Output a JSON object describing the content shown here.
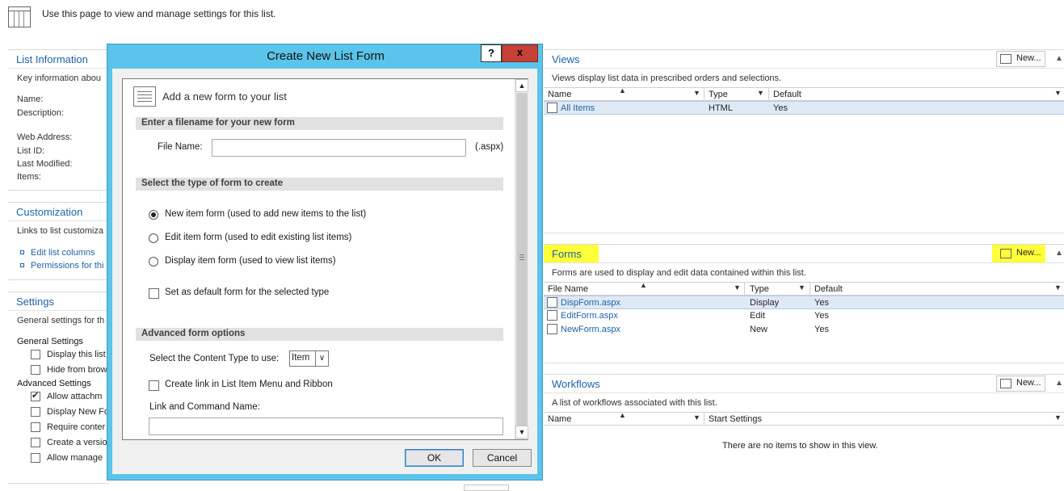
{
  "page": {
    "subtitle": "Use this page to view and manage settings for this list."
  },
  "left": {
    "list_information": {
      "title": "List Information",
      "desc": "Key information abou",
      "fields": [
        "Name:",
        "Description:",
        "Web Address:",
        "List ID:",
        "Last Modified:",
        "Items:"
      ]
    },
    "customization": {
      "title": "Customization",
      "desc": "Links to list customiza",
      "links": [
        "Edit list columns",
        "Permissions for thi"
      ]
    },
    "settings": {
      "title": "Settings",
      "desc": "General settings for th",
      "general_heading": "General Settings",
      "general_items": [
        {
          "label": "Display this list",
          "checked": false
        },
        {
          "label": "Hide from brow",
          "checked": false
        }
      ],
      "advanced_heading": "Advanced Settings",
      "advanced_items": [
        {
          "label": "Allow attachm",
          "checked": true
        },
        {
          "label": "Display New Fo",
          "checked": false
        },
        {
          "label": "Require conter",
          "checked": false
        },
        {
          "label": "Create a versio",
          "checked": false
        },
        {
          "label": "Allow manage",
          "checked": false
        }
      ]
    }
  },
  "views": {
    "title": "Views",
    "new_label": "New...",
    "desc": "Views display list data in prescribed orders and selections.",
    "columns": [
      "Name",
      "Type",
      "Default"
    ],
    "rows": [
      {
        "name": "All Items",
        "type": "HTML",
        "default": "Yes"
      }
    ]
  },
  "forms": {
    "title": "Forms",
    "new_label": "New...",
    "desc": "Forms are used to display and edit data contained within this list.",
    "columns": [
      "File Name",
      "Type",
      "Default"
    ],
    "rows": [
      {
        "name": "DispForm.aspx",
        "type": "Display",
        "default": "Yes"
      },
      {
        "name": "EditForm.aspx",
        "type": "Edit",
        "default": "Yes"
      },
      {
        "name": "NewForm.aspx",
        "type": "New",
        "default": "Yes"
      }
    ]
  },
  "workflows": {
    "title": "Workflows",
    "new_label": "New...",
    "desc": "A list of workflows associated with this list.",
    "columns": [
      "Name",
      "Start Settings"
    ],
    "empty": "There are no items to show in this view."
  },
  "dialog": {
    "title": "Create New List Form",
    "help": "?",
    "close": "x",
    "header": "Add a new form to your list",
    "section_filename": "Enter a filename for your new form",
    "file_name_label": "File Name:",
    "file_name_value": "",
    "ext": "(.aspx)",
    "section_type": "Select the type of form to create",
    "options": [
      {
        "label": "New item form (used to add new items to the list)",
        "selected": true
      },
      {
        "label": "Edit item form (used to edit existing list items)",
        "selected": false
      },
      {
        "label": "Display item form (used to view list items)",
        "selected": false
      }
    ],
    "default_checkbox": "Set as default form for the selected type",
    "section_advanced": "Advanced form options",
    "content_type_label": "Select the Content Type to use:",
    "content_type_value": "Item",
    "create_link_label": "Create link in List Item Menu and Ribbon",
    "link_name_label": "Link and Command Name:",
    "link_name_value": "",
    "ok": "OK",
    "cancel": "Cancel"
  },
  "colors": {
    "dialog_frame": "#5bc4ea",
    "close_button": "#c74137",
    "link": "#1e63a6",
    "highlight": "#ffff3a"
  }
}
